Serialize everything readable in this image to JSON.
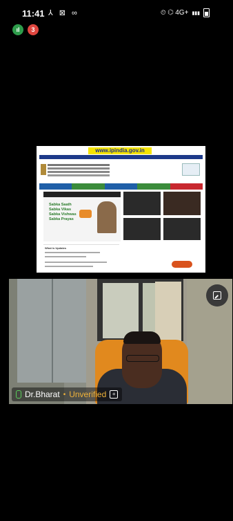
{
  "status_bar": {
    "time": "11:41",
    "left_icons": "⅄ ⊠ ∞",
    "right_icons": "⏲ ⌬ 4G+",
    "signal": "▮▮▮"
  },
  "badges": [
    {
      "text": "ıl",
      "color": "#2e9c4b"
    },
    {
      "text": "3",
      "color": "#e0463f"
    }
  ],
  "shared_screen": {
    "url": "www.ipindia.gov.in",
    "menu_colors": [
      "#1f5fa8",
      "#3b8c3b",
      "#1f5fa8",
      "#3b8c3b",
      "#c8282f"
    ],
    "hero_text": "Sabka Saath\nSabka Vikas\nSabka Vishwas\nSabka Prayas",
    "updates_title": "What is Updates"
  },
  "video": {
    "participant_name": "Dr.Bharat",
    "separator": "•",
    "status": "Unverified",
    "info_icon": "+"
  },
  "icons": {
    "pip": "picture-in-picture-icon",
    "mic": "mic-icon"
  }
}
